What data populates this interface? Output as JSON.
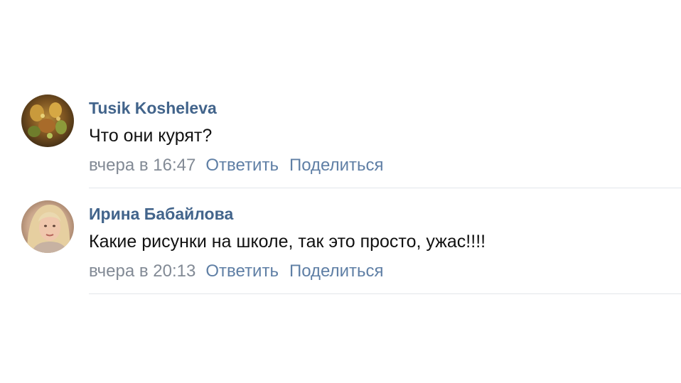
{
  "comments": [
    {
      "author": "Tusik Kosheleva",
      "text": "Что они курят?",
      "time": "вчера в 16:47",
      "reply_label": "Ответить",
      "share_label": "Поделиться"
    },
    {
      "author": "Ирина Бабайлова",
      "text": "Какие рисунки на школе, так это просто, ужас!!!!",
      "time": "вчера в 20:13",
      "reply_label": "Ответить",
      "share_label": "Поделиться"
    }
  ],
  "colors": {
    "author_link": "#42648b",
    "action_link": "#5f7fa5",
    "meta_text": "#828a95",
    "divider": "#e3e6ea"
  }
}
